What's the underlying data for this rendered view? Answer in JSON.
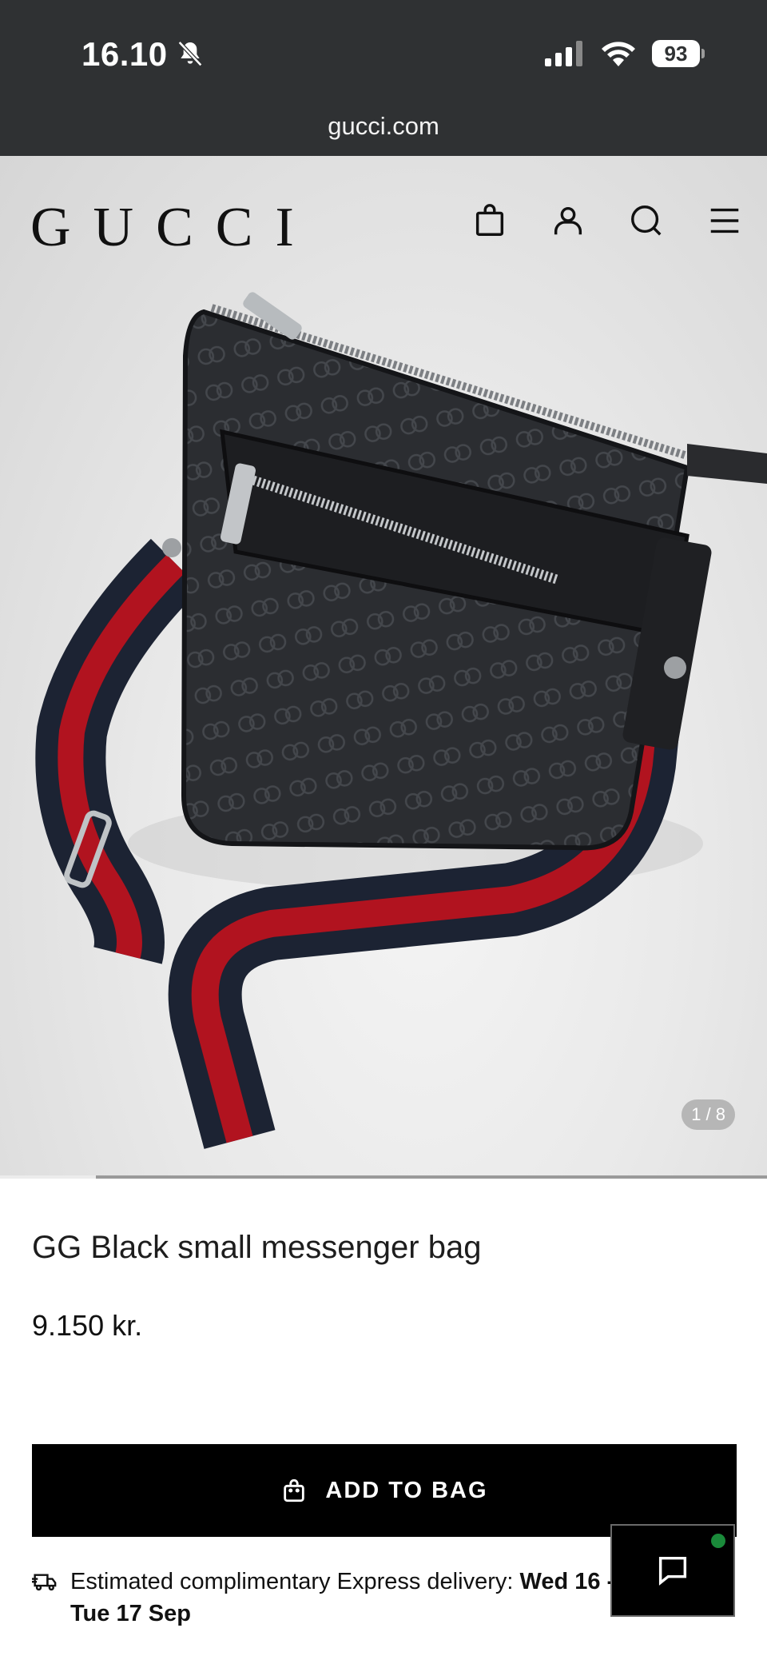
{
  "status": {
    "time": "16.10",
    "battery": "93",
    "url": "gucci.com"
  },
  "header": {
    "brand": "GUCCI"
  },
  "gallery": {
    "counter": "1 / 8",
    "index": 1,
    "total": 8
  },
  "product": {
    "title": "GG Black small messenger bag",
    "price": "9.150 kr."
  },
  "actions": {
    "add_to_bag": "ADD TO BAG"
  },
  "delivery": {
    "prefix": "Estimated complimentary Express delivery: ",
    "dates": "Wed 16 - Tue 17 Sep"
  },
  "icons": {
    "header": [
      "shopping-bag-icon",
      "account-icon",
      "search-icon",
      "menu-icon"
    ],
    "status": [
      "bell-muted-icon",
      "signal-icon",
      "wifi-icon",
      "battery-icon"
    ],
    "other": [
      "truck-icon",
      "chat-icon"
    ]
  },
  "colors": {
    "status_bar": "#2f3133",
    "button": "#000000",
    "chat_online": "#1a8a3a"
  }
}
